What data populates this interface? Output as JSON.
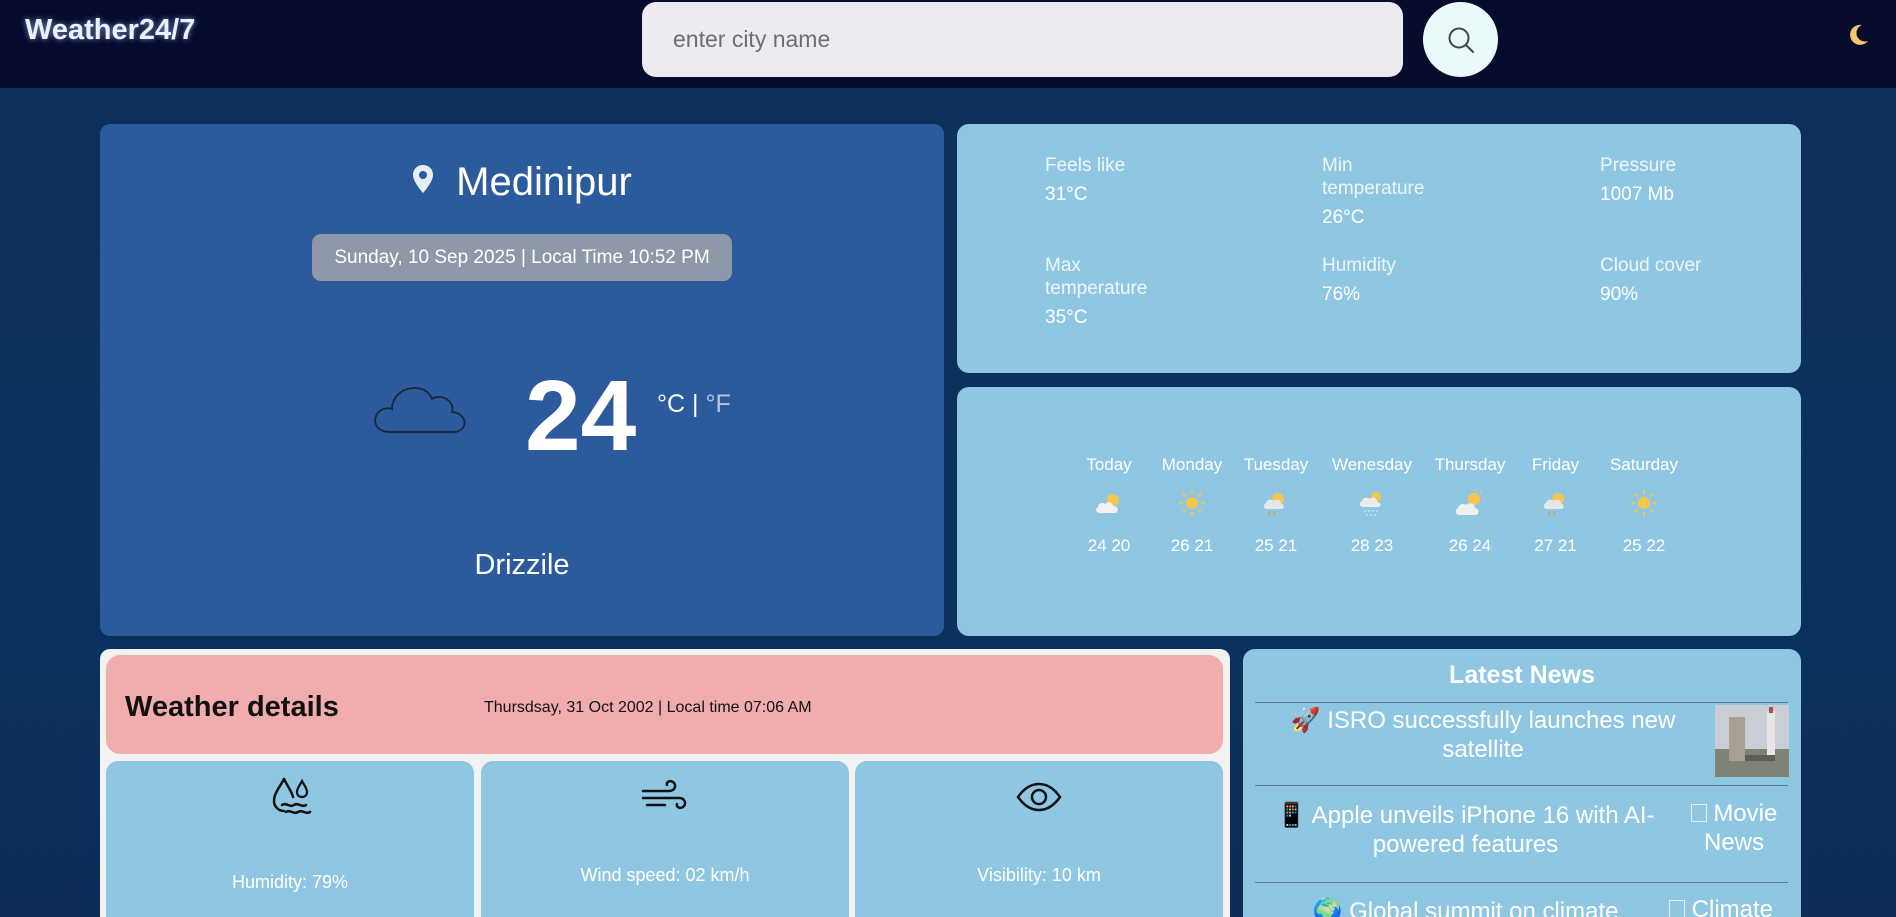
{
  "header": {
    "brand": "Weather24/7",
    "search_placeholder": "enter city name",
    "icons": {
      "search": "search-icon",
      "theme": "moon-icon"
    }
  },
  "current": {
    "city": "Medinipur",
    "datetime": "Sunday, 10 Sep 2025 | Local Time 10:52 PM",
    "temperature": "24",
    "unit_c": "°C",
    "unit_sep": "|",
    "unit_f": "°F",
    "condition": "Drizzile",
    "icon": "cloud-icon"
  },
  "stats": [
    {
      "label": "Feels like",
      "value": "31°C"
    },
    {
      "label": "Min temperature",
      "value": "26°C"
    },
    {
      "label": "Pressure",
      "value": "1007 Mb"
    },
    {
      "label": "Max temperature",
      "value": "35°C"
    },
    {
      "label": "Humidity",
      "value": "76%"
    },
    {
      "label": "Cloud cover",
      "value": "90%"
    }
  ],
  "forecast": [
    {
      "day": "Today",
      "temps": "24 20",
      "icon": "partly-cloudy-icon"
    },
    {
      "day": "Monday",
      "temps": "26 21",
      "icon": "sun-icon"
    },
    {
      "day": "Tuesday",
      "temps": "25 21",
      "icon": "sun-rain-icon"
    },
    {
      "day": "Wenesday",
      "temps": "28 23",
      "icon": "cloud-rain-icon"
    },
    {
      "day": "Thursday",
      "temps": "26 24",
      "icon": "sun-cloud-icon"
    },
    {
      "day": "Friday",
      "temps": "27 21",
      "icon": "sun-rain-icon"
    },
    {
      "day": "Saturday",
      "temps": "25 22",
      "icon": "sun-icon"
    }
  ],
  "details": {
    "title": "Weather details",
    "datetime": "Thursdsay, 31 Oct 2002 | Local time 07:06 AM",
    "cards": [
      {
        "text": "Humidity: 79%",
        "icon": "humidity-icon"
      },
      {
        "text": "Wind speed: 02 km/h",
        "icon": "wind-icon"
      },
      {
        "text": "Visibility: 10 km",
        "icon": "eye-icon"
      }
    ]
  },
  "news": {
    "title": "Latest News",
    "items": [
      {
        "emoji": "🚀",
        "text": "ISRO successfully launches new satellite",
        "image_alt": ""
      },
      {
        "emoji": "📱",
        "text": "Apple unveils iPhone 16 with AI-powered features",
        "image_alt": "Movie News"
      },
      {
        "emoji": "🌍",
        "text": "Global summit on climate",
        "image_alt": "Climate"
      }
    ]
  }
}
